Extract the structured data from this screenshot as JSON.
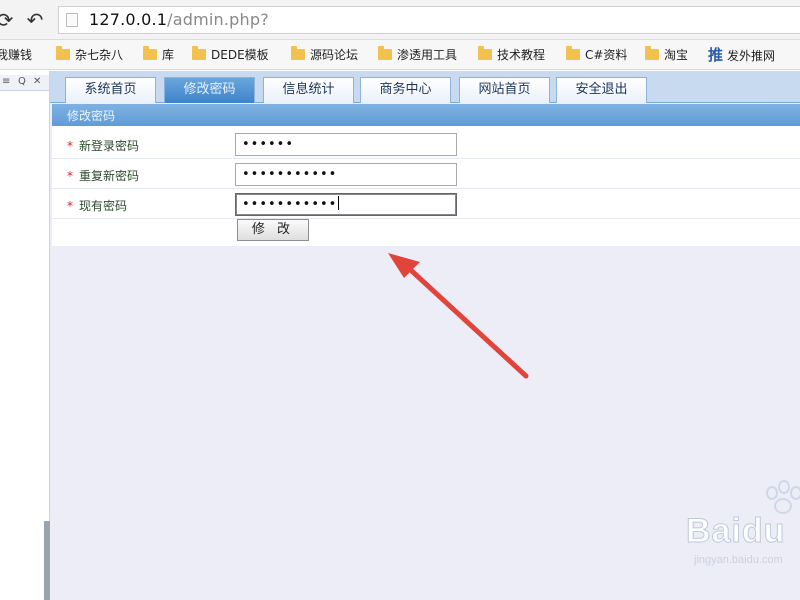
{
  "browser": {
    "url_host": "127.0.0.1",
    "url_path": "/admin.php?"
  },
  "bookmarks": [
    {
      "label": "我赚钱",
      "icon": "none"
    },
    {
      "label": "杂七杂八",
      "icon": "folder-icon"
    },
    {
      "label": "库",
      "icon": "folder-icon"
    },
    {
      "label": "DEDE模板",
      "icon": "folder-icon"
    },
    {
      "label": "源码论坛",
      "icon": "folder-icon"
    },
    {
      "label": "渗透用工具",
      "icon": "folder-icon"
    },
    {
      "label": "技术教程",
      "icon": "folder-icon"
    },
    {
      "label": "C#资料",
      "icon": "folder-icon"
    },
    {
      "label": "淘宝",
      "icon": "folder-icon"
    },
    {
      "label": "发外推网",
      "icon": "tui-icon"
    }
  ],
  "left_panel": {
    "icons": [
      "pin-icon",
      "search-icon",
      "close-icon"
    ],
    "icon_glyphs": [
      "≡",
      "Q",
      "✕"
    ]
  },
  "tabs": [
    {
      "label": "系统首页",
      "active": false
    },
    {
      "label": "修改密码",
      "active": true
    },
    {
      "label": "信息统计",
      "active": false
    },
    {
      "label": "商务中心",
      "active": false
    },
    {
      "label": "网站首页",
      "active": false
    },
    {
      "label": "安全退出",
      "active": false
    }
  ],
  "section": {
    "title": "修改密码"
  },
  "form": {
    "required_mark": "*",
    "fields": [
      {
        "label": "新登录密码",
        "value": "••••••",
        "focused": false
      },
      {
        "label": "重复新密码",
        "value": "•••••••••••",
        "focused": false
      },
      {
        "label": "现有密码",
        "value": "•••••••••••",
        "focused": true
      }
    ],
    "submit_label": "修 改"
  },
  "colors": {
    "tab_active": "#4a8fd3",
    "section_bar": "#6aa4dc",
    "required": "#dd2222",
    "arrow": "#e0443a",
    "page_bg": "#ecedf7"
  },
  "watermark": {
    "brand": "Baidu",
    "url": "jingyan.baidu.com"
  }
}
